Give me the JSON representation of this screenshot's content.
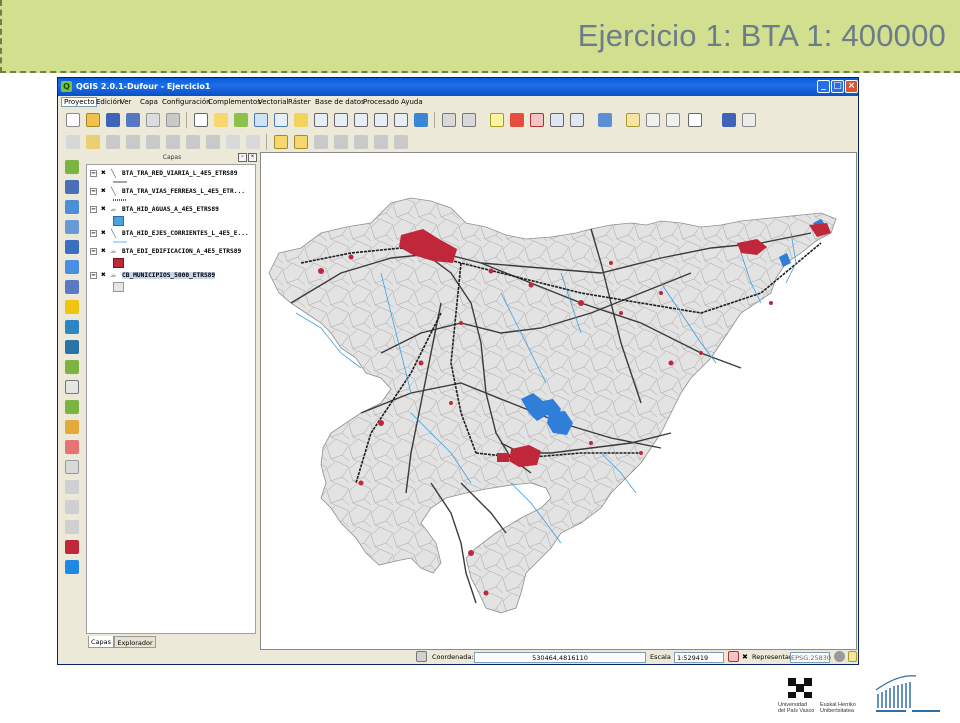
{
  "slide": {
    "title": "Ejercicio 1: BTA 1: 400000"
  },
  "window": {
    "title": "QGIS 2.0.1-Dufour - Ejercicio1",
    "app_icon_glyph": "Q"
  },
  "menu": [
    {
      "label": "Proyecto",
      "active": true
    },
    {
      "label": "Edición"
    },
    {
      "label": "Ver"
    },
    {
      "label": "Capa"
    },
    {
      "label": "Configuración"
    },
    {
      "label": "Complementos"
    },
    {
      "label": "Vectorial"
    },
    {
      "label": "Ráster"
    },
    {
      "label": "Base de datos"
    },
    {
      "label": "Procesado"
    },
    {
      "label": "Ayuda"
    }
  ],
  "layers_panel": {
    "title": "Capas",
    "tabs": [
      {
        "label": "Capas",
        "active": true
      },
      {
        "label": "Explorador"
      }
    ],
    "layers": [
      {
        "name": "BTA_TRA_RED_VIARIA_L_4E5_ETRS89",
        "geometry": "line",
        "symbol_color": "#4a4a4a",
        "checked": true
      },
      {
        "name": "BTA_TRA_VIAS_FERREAS_L_4E5_ETR...",
        "geometry": "line",
        "symbol_color": "#222222",
        "checked": true
      },
      {
        "name": "BTA_HID_AGUAS_A_4E5_ETRS89",
        "geometry": "polygon",
        "symbol_color": "#4aa3df",
        "checked": true
      },
      {
        "name": "BTA_HID_EJES_CORRIENTES_L_4E5_E...",
        "geometry": "line",
        "symbol_color": "#5ab4e8",
        "checked": true
      },
      {
        "name": "BTA_EDI_EDIFICACION_A_4E5_ETRS89",
        "geometry": "polygon",
        "symbol_color": "#c0273a",
        "checked": true
      },
      {
        "name": "CB_MUNICIPIOS_5000_ETRS89",
        "geometry": "polygon",
        "symbol_color": "#e6e6e6",
        "checked": true,
        "selected": true
      }
    ]
  },
  "status": {
    "coord_label": "Coordenada:",
    "coord_value": "530464,4816110",
    "scale_label": "Escala",
    "scale_value": "1:529419",
    "render_label": "Representar",
    "render_checked": true,
    "crs": "EPSG:25830"
  },
  "logos": {
    "ehu_line1": "Universidad",
    "ehu_line2": "del País Vasco",
    "ehu_line3": "Euskal Herriko",
    "ehu_line4": "Unibertsitatea"
  },
  "colors": {
    "header_bg": "#d2df8f",
    "title_color": "#6d7c8b",
    "roads": "#3b3b3b",
    "rail": "#1f1f1f",
    "water_lines": "#3aa0e0",
    "water_areas": "#2f7ed8",
    "buildings": "#c0273a",
    "municipalities_fill": "#e3e3e3",
    "municipalities_stroke": "#9a9a9a"
  }
}
